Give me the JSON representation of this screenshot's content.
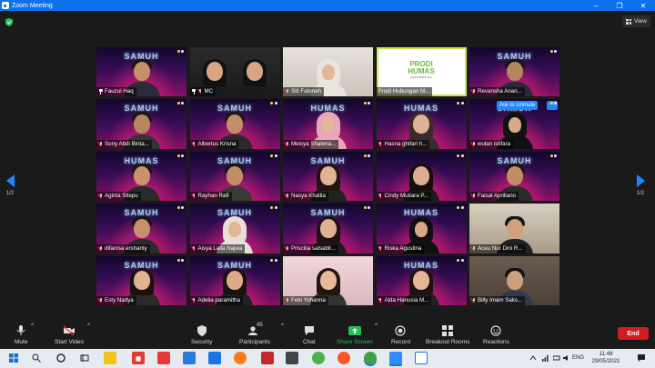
{
  "window": {
    "title": "Zoom Meeting",
    "minimize": "–",
    "maximize": "❐",
    "close": "✕"
  },
  "meeting": {
    "view_label": "View",
    "page_indicator_left": "1/2",
    "page_indicator_right": "1/2",
    "ask_to_unmute": "Ask to Unmute",
    "more_dots": "···",
    "tiles": [
      {
        "name": "Fauzul Haq",
        "badge": "pin",
        "bg": "samuh",
        "brand": "SAMUH",
        "skin": "#c8906a",
        "hair": "#1a1410",
        "shirt": "#2b2b3a",
        "style": "man"
      },
      {
        "name": "MC",
        "badge": "mic-pin",
        "bg": "dark",
        "brand": "",
        "skin": "#d6a584",
        "hair": "#111",
        "shirt": "#1b1b1b",
        "style": "duo"
      },
      {
        "name": "Siti Fatonah",
        "badge": "mic",
        "bg": "light",
        "brand": "",
        "skin": "#e0b89b",
        "hair": "#e9e4dc",
        "shirt": "#e9e4dc",
        "style": "hijab"
      },
      {
        "name": "Prodi Hubungan M...",
        "badge": "none",
        "bg": "logo",
        "brand": "",
        "skin": "",
        "hair": "",
        "shirt": "",
        "style": "logo"
      },
      {
        "name": "Revansha Anan...",
        "badge": "mic",
        "bg": "samuh",
        "brand": "SAMUH",
        "skin": "#b78462",
        "hair": "#151515",
        "shirt": "#2a2a38",
        "style": "man"
      },
      {
        "name": "Sony Abdi Binta...",
        "badge": "mic",
        "bg": "samuh",
        "brand": "SAMUH",
        "skin": "#b98460",
        "hair": "#171717",
        "shirt": "#333",
        "style": "man"
      },
      {
        "name": "Albertus Krisna",
        "badge": "mic",
        "bg": "samuh",
        "brand": "SAMUH",
        "skin": "#c58e6a",
        "hair": "#181818",
        "shirt": "#2a2a2a",
        "style": "man"
      },
      {
        "name": "Meisya Shalena...",
        "badge": "mic",
        "bg": "samuh",
        "brand": "HUMAS",
        "skin": "#e4b79a",
        "hair": "#e7a7b8",
        "shirt": "#e7a7b8",
        "style": "hijab"
      },
      {
        "name": "Hasna ghifari h...",
        "badge": "mic",
        "bg": "samuh",
        "brand": "HUMAS",
        "skin": "#deb296",
        "hair": "#3a2a2a",
        "shirt": "#3a2a2a",
        "style": "none"
      },
      {
        "name": "wulan istifara",
        "badge": "mic",
        "bg": "samuh",
        "brand": "SAMUH",
        "skin": "#d9a98a",
        "hair": "#111",
        "shirt": "#111",
        "style": "hijab"
      },
      {
        "name": "Aginta Sitepu",
        "badge": "mic",
        "bg": "samuh",
        "brand": "HUMAS",
        "skin": "#c9926d",
        "hair": "#161616",
        "shirt": "#2a2a2a",
        "style": "man"
      },
      {
        "name": "Rayhan Rafi",
        "badge": "mic",
        "bg": "samuh",
        "brand": "SAMUH",
        "skin": "#c48c66",
        "hair": "#161616",
        "shirt": "#3a3a3a",
        "style": "man"
      },
      {
        "name": "Nasya Khalila",
        "badge": "mic",
        "bg": "samuh",
        "brand": "SAMUH",
        "skin": "#e1b395",
        "hair": "#201512",
        "shirt": "#222",
        "style": "longhair"
      },
      {
        "name": "Cindy Mutiara P...",
        "badge": "mic",
        "bg": "samuh",
        "brand": "",
        "skin": "#dcae8f",
        "hair": "#140e0c",
        "shirt": "#1c1c1c",
        "style": "longhair"
      },
      {
        "name": "Faisal Apriliano",
        "badge": "mic",
        "bg": "samuh",
        "brand": "SAMUH",
        "skin": "#c38b66",
        "hair": "#161616",
        "shirt": "#2b2b2b",
        "style": "man"
      },
      {
        "name": "difanisa ershanty",
        "badge": "mic",
        "bg": "samuh",
        "brand": "SAMUH",
        "skin": "#c89070",
        "hair": "#151515",
        "shirt": "#2b2b2b",
        "style": "man"
      },
      {
        "name": "Aisya Laila Najwa",
        "badge": "mic",
        "bg": "samuh",
        "brand": "SAMUH",
        "skin": "#e2b597",
        "hair": "#e8e0d8",
        "shirt": "#e8e0d8",
        "style": "hijab"
      },
      {
        "name": "Priscilia salsabil...",
        "badge": "mic",
        "bg": "samuh",
        "brand": "SAMUH",
        "skin": "#e0b092",
        "hair": "#1d1412",
        "shirt": "#1d1d1d",
        "style": "longhair"
      },
      {
        "name": "Riska Agustina",
        "badge": "mic",
        "bg": "samuh",
        "brand": "HUMAS",
        "skin": "#d8a787",
        "hair": "#101010",
        "shirt": "#101010",
        "style": "hijab"
      },
      {
        "name": "Aceu Nur Dini R...",
        "badge": "mic",
        "bg": "office",
        "brand": "",
        "skin": "#d3a07e",
        "hair": "#141414",
        "shirt": "#222",
        "style": "man"
      },
      {
        "name": "Esty Nadya",
        "badge": "mic",
        "bg": "samuh",
        "brand": "SAMUH",
        "skin": "#e2b293",
        "hair": "#1a120f",
        "shirt": "#2a2a2a",
        "style": "longhair"
      },
      {
        "name": "Adelia paramitha",
        "badge": "mic",
        "bg": "samuh",
        "brand": "SAMUH",
        "skin": "#ddab8c",
        "hair": "#181210",
        "shirt": "#222",
        "style": "longhair"
      },
      {
        "name": "Febi Yohanna",
        "badge": "mic",
        "bg": "pink",
        "brand": "",
        "skin": "#e5b99c",
        "hair": "#22160f",
        "shirt": "#333",
        "style": "longhair"
      },
      {
        "name": "Alda Hanusia M...",
        "badge": "mic",
        "bg": "samuh",
        "brand": "HUMAS",
        "skin": "#e3b596",
        "hair": "#1b1310",
        "shirt": "#222",
        "style": "longhair"
      },
      {
        "name": "Billy Imam Saks...",
        "badge": "mic",
        "bg": "room",
        "brand": "",
        "skin": "#caa07f",
        "hair": "#141414",
        "shirt": "#2f3a4a",
        "style": "man"
      }
    ],
    "logo": {
      "line1": "PRODI",
      "line2": "HUMAS",
      "line3": "www.UPNVJ.com"
    }
  },
  "toolbar": {
    "mute": "Mute",
    "start_video": "Start Video",
    "security": "Security",
    "participants": "Participants",
    "participants_count": "45",
    "chat": "Chat",
    "share_screen": "Share Screen",
    "record": "Record",
    "breakout_rooms": "Breakout Rooms",
    "reactions": "Reactions",
    "end": "End",
    "caret": "^"
  },
  "taskbar": {
    "language": "ENG",
    "time": "11.48",
    "date": "29/05/2021"
  },
  "colors": {
    "accent": "#0e71eb",
    "share": "#27c256",
    "end": "#d11d1d",
    "active_border": "#c8e64a"
  }
}
